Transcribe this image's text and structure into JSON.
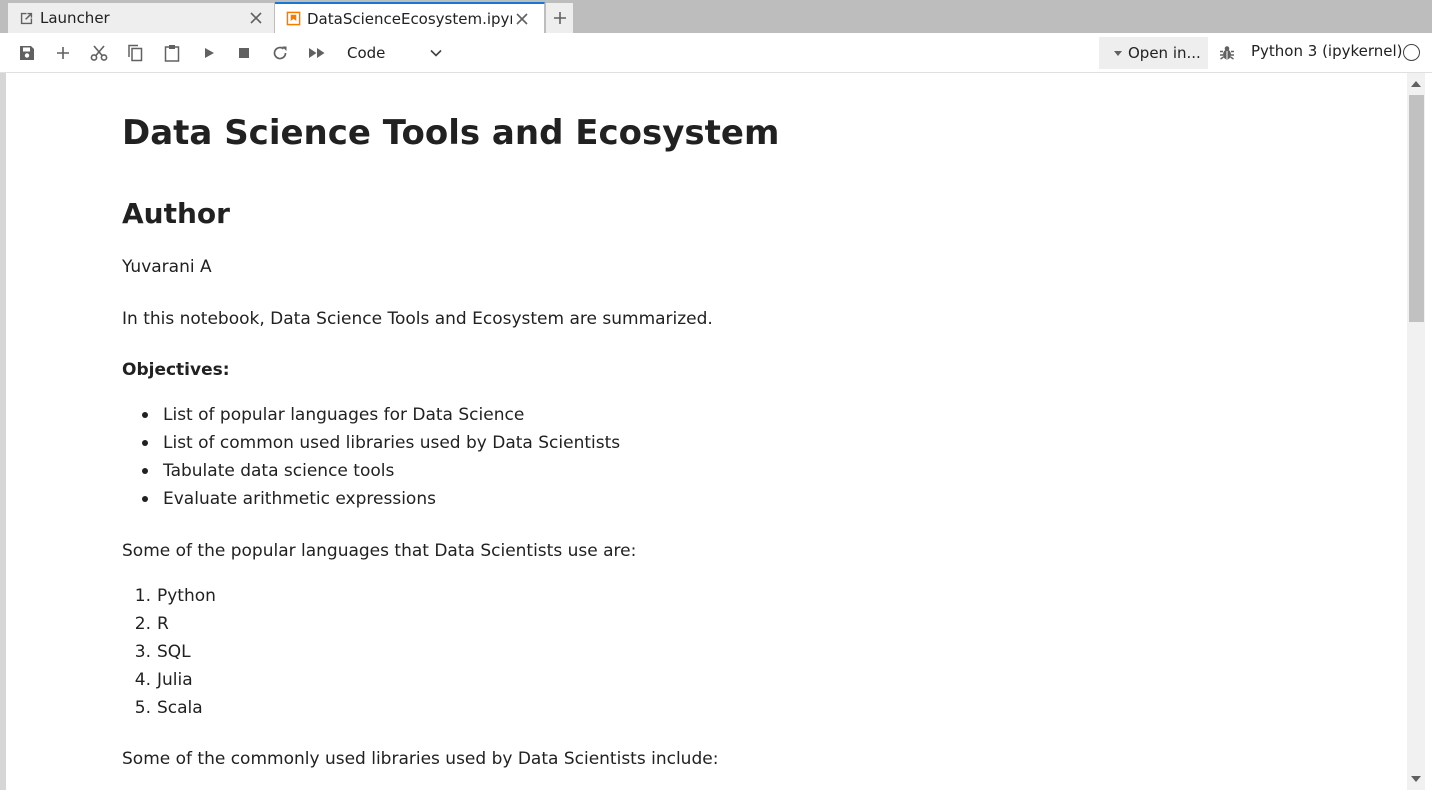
{
  "tabs": [
    {
      "label": "Launcher",
      "icon": "launcher-icon"
    },
    {
      "label": "DataScienceEcosystem.ipynb",
      "icon": "notebook-icon",
      "active": true
    }
  ],
  "toolbar": {
    "cell_type": "Code",
    "open_in": "Open in...",
    "kernel": "Python 3 (ipykernel)"
  },
  "notebook": {
    "title": "Data Science Tools and Ecosystem",
    "author_heading": "Author",
    "author": "Yuvarani A",
    "intro": "In this notebook, Data Science Tools and Ecosystem are summarized.",
    "objectives_label": "Objectives:",
    "objectives": [
      "List of popular languages for Data Science",
      "List of common used libraries used by Data Scientists",
      "Tabulate data science tools",
      "Evaluate arithmetic expressions"
    ],
    "languages_intro": "Some of the popular languages that Data Scientists use are:",
    "languages": [
      "Python",
      "R",
      "SQL",
      "Julia",
      "Scala"
    ],
    "libraries_intro": "Some of the commonly used libraries used by Data Scientists include:"
  },
  "colors": {
    "active_tab_accent": "#1976d2",
    "notebook_icon": "#f57c00"
  }
}
